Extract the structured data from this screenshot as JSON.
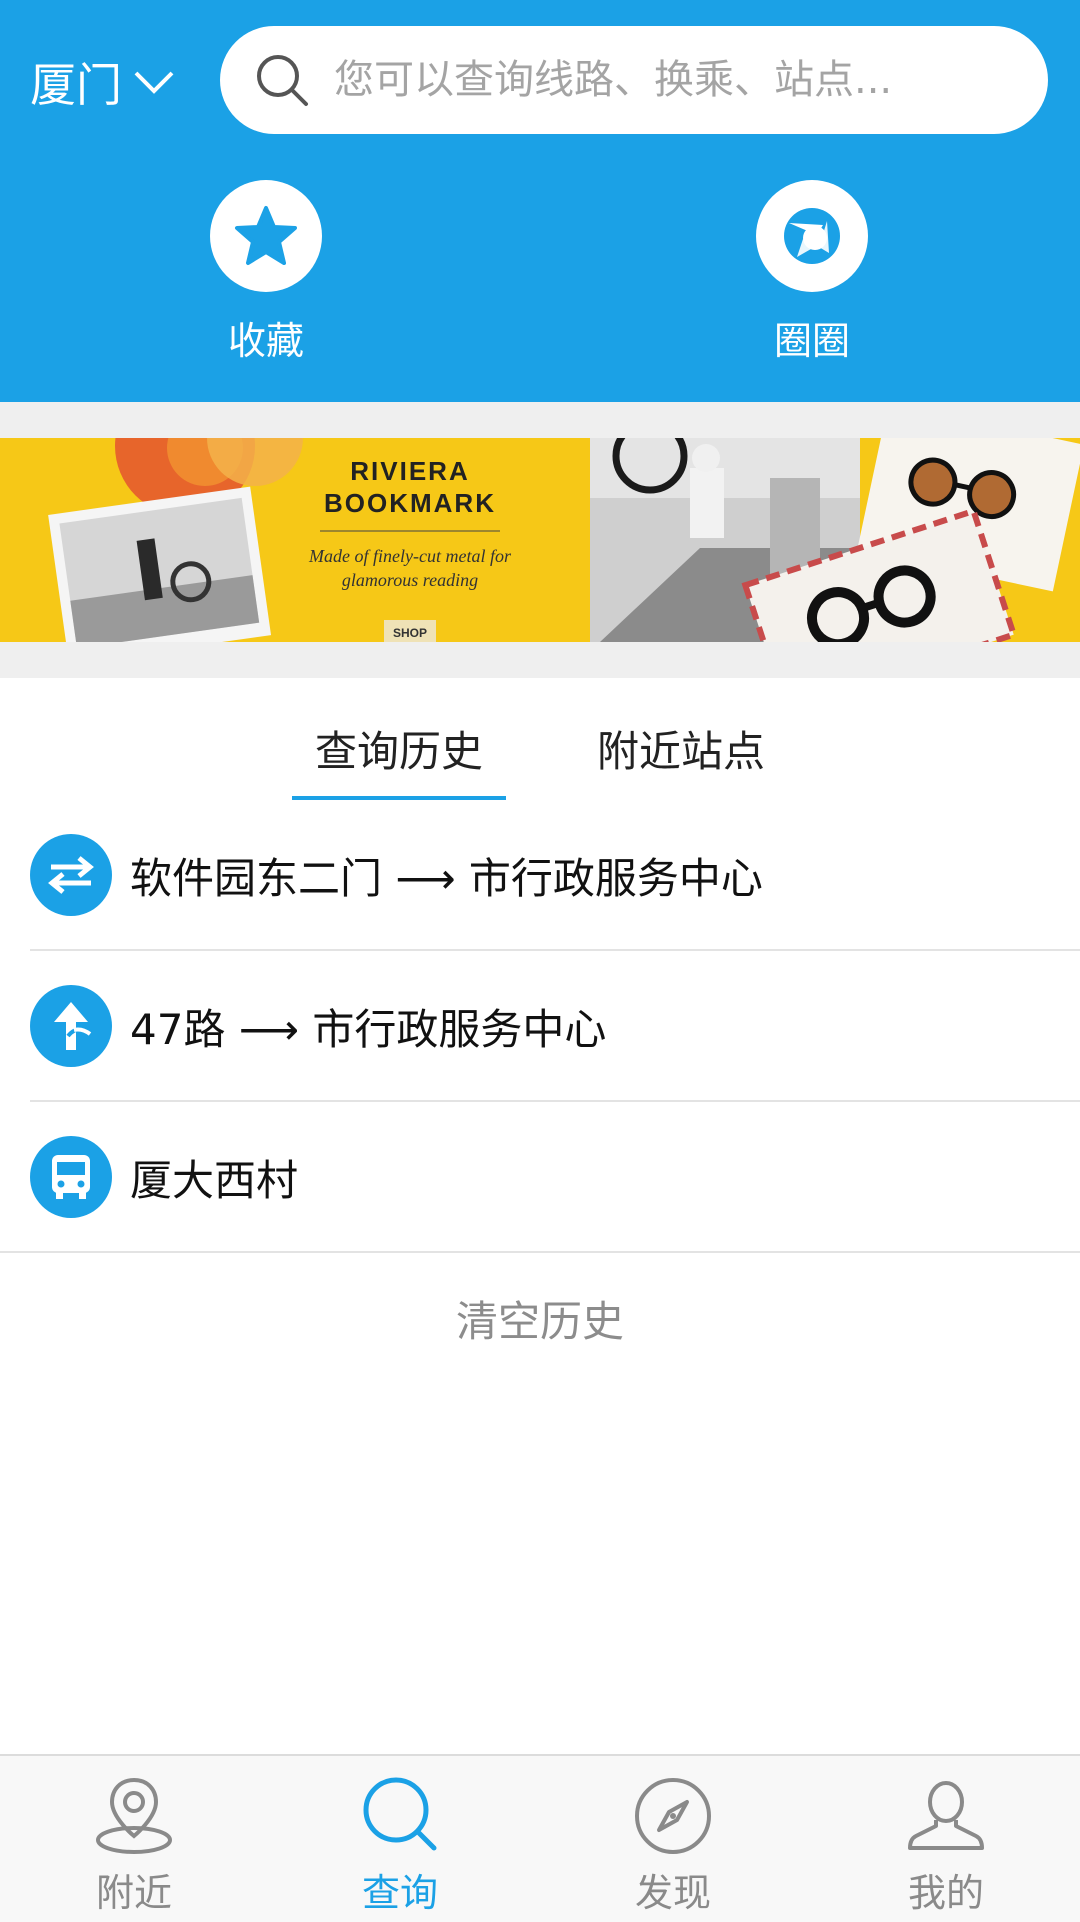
{
  "header": {
    "city": "厦门",
    "search_placeholder": "您可以查询线路、换乘、站点...",
    "quick_actions": [
      {
        "label": "收藏",
        "icon": "star-icon"
      },
      {
        "label": "圈圈",
        "icon": "circle-ring-icon"
      }
    ]
  },
  "banner": {
    "title_line1": "RIVIERA",
    "title_line2": "BOOKMARK",
    "subtitle_line1": "Made of finely-cut metal for",
    "subtitle_line2": "glamorous reading",
    "cta": "SHOP"
  },
  "tabs": [
    {
      "label": "查询历史",
      "active": true
    },
    {
      "label": "附近站点",
      "active": false
    }
  ],
  "history": [
    {
      "icon": "transfer-icon",
      "text": "软件园东二门 ⟶ 市行政服务中心"
    },
    {
      "icon": "route-icon",
      "text": "47路 ⟶ 市行政服务中心"
    },
    {
      "icon": "bus-icon",
      "text": "厦大西村"
    }
  ],
  "clear_label": "清空历史",
  "bottom_nav": [
    {
      "label": "附近",
      "icon": "location-pin-icon",
      "active": false
    },
    {
      "label": "查询",
      "icon": "search-icon",
      "active": true
    },
    {
      "label": "发现",
      "icon": "compass-icon",
      "active": false
    },
    {
      "label": "我的",
      "icon": "person-icon",
      "active": false
    }
  ],
  "colors": {
    "primary": "#1ba1e6",
    "banner_yellow": "#f6c817",
    "text_dark": "#111111",
    "text_muted": "#8c8c8c"
  }
}
